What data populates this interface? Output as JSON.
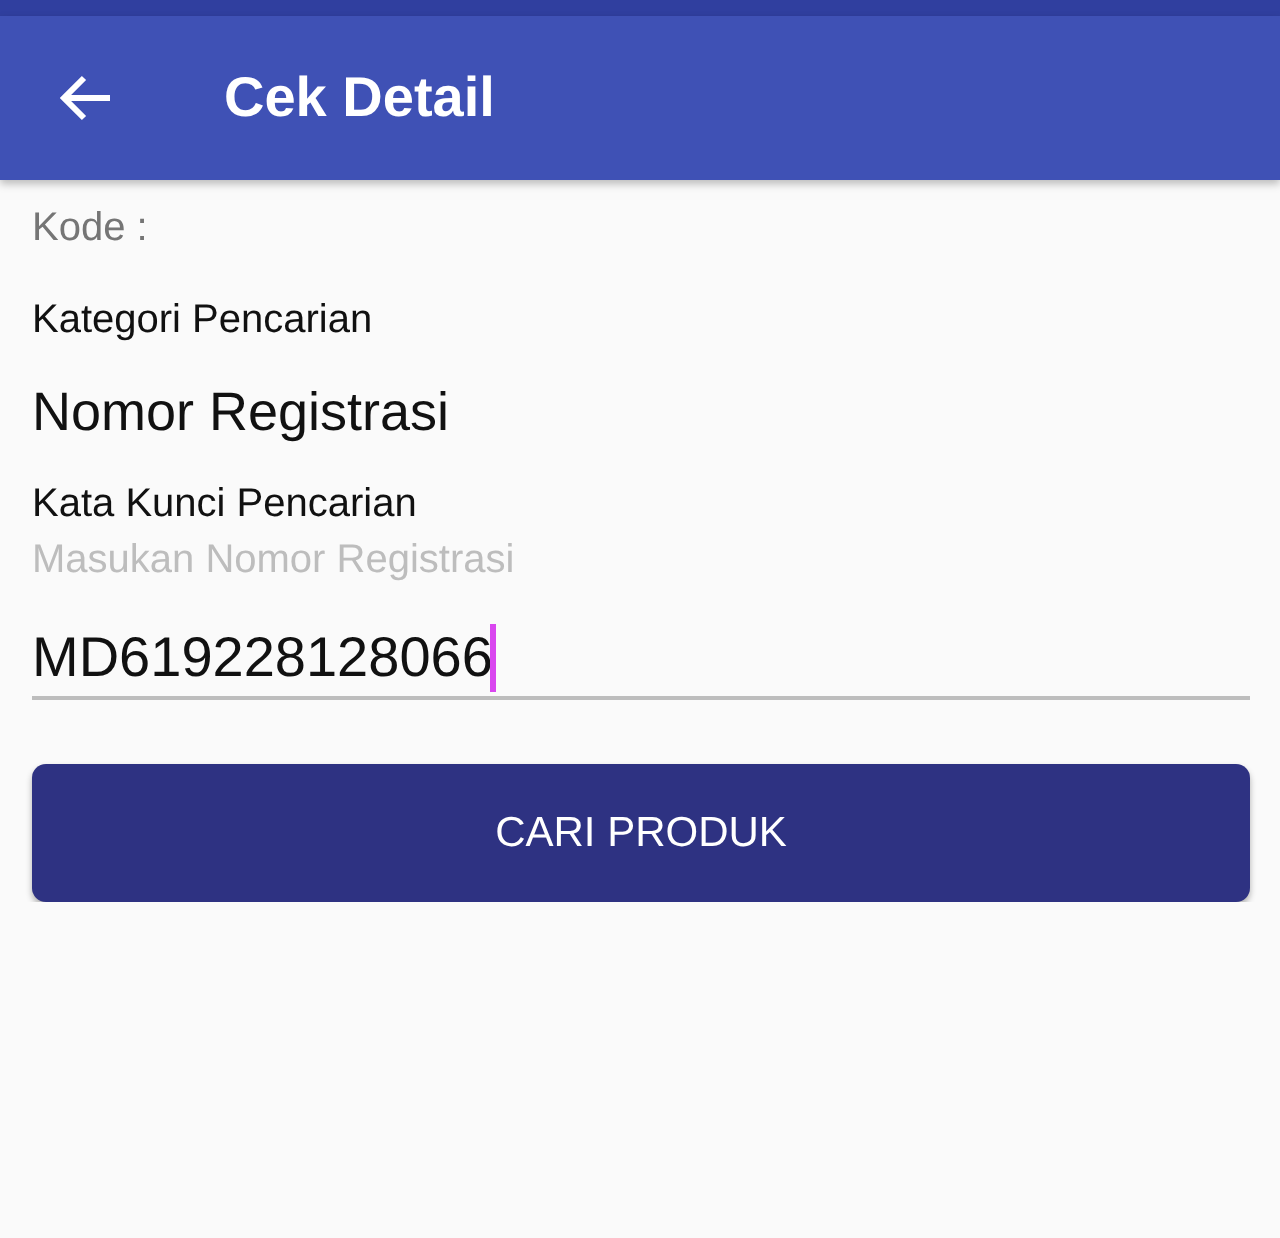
{
  "app_bar": {
    "title": "Cek Detail"
  },
  "form": {
    "code_label": "Kode :",
    "category_label": "Kategori Pencarian",
    "category_value": "Nomor Registrasi",
    "keyword_label": "Kata Kunci Pencarian",
    "field": {
      "hint": "Masukan Nomor Registrasi",
      "value": "MD619228128066",
      "focused": true
    },
    "button": "CARI PRODUK"
  }
}
